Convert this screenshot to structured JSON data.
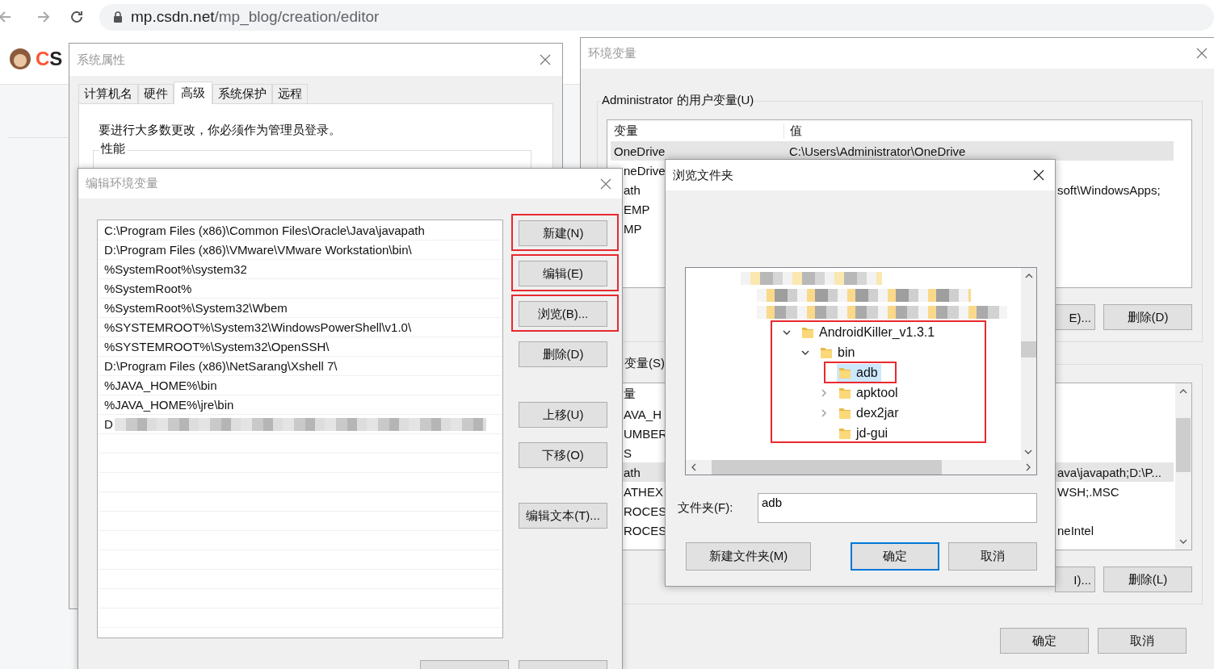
{
  "browser": {
    "url_host": "mp.csdn.net",
    "url_path": "/mp_blog/creation/editor",
    "logo_text": "CS"
  },
  "system_properties": {
    "title": "系统属性",
    "active": false,
    "tabs": [
      {
        "label": "计算机名",
        "selected": false
      },
      {
        "label": "硬件",
        "selected": false
      },
      {
        "label": "高级",
        "selected": true
      },
      {
        "label": "系统保护",
        "selected": false
      },
      {
        "label": "远程",
        "selected": false
      }
    ],
    "notice": "要进行大多数更改，你必须作为管理员登录。",
    "group_label": "性能"
  },
  "environment_variables": {
    "title": "环境变量",
    "active": false,
    "user_group": {
      "label": "Administrator 的用户变量(U)",
      "header": {
        "name": "变量",
        "value": "值"
      },
      "rows": [
        {
          "name": "OneDrive",
          "value": "C:\\Users\\Administrator\\OneDrive",
          "name_cut": false,
          "value_cut": false,
          "selected": true
        },
        {
          "name": "neDrive",
          "name_cut": true,
          "selected": false
        },
        {
          "name": "ath",
          "value": "soft\\WindowsApps;",
          "name_cut": true,
          "value_cut": true,
          "selected": false
        },
        {
          "name": "EMP",
          "name_cut": true,
          "selected": false
        },
        {
          "name": "MP",
          "name_cut": true,
          "selected": false
        }
      ],
      "buttons": [
        "E)...",
        "删除(D)"
      ]
    },
    "system_group": {
      "label": "变量(S)",
      "header": {
        "name": "量"
      },
      "rows": [
        {
          "name": "AVA_H",
          "name_cut": true,
          "selected": false
        },
        {
          "name": "UMBER",
          "name_cut": true,
          "selected": false
        },
        {
          "name": "S",
          "name_cut": true,
          "selected": false
        },
        {
          "name": "ath",
          "value": "ava\\javapath;D:\\P...",
          "name_cut": true,
          "value_cut": true,
          "selected": true
        },
        {
          "name": "ATHEX",
          "value": "WSH;.MSC",
          "name_cut": true,
          "value_cut": true,
          "selected": false
        },
        {
          "name": "ROCES",
          "name_cut": true,
          "selected": false
        },
        {
          "name": "ROCES",
          "value": "neIntel",
          "name_cut": true,
          "value_cut": true,
          "selected": false
        }
      ],
      "buttons": [
        "I)...",
        "删除(L)"
      ]
    },
    "buttons": [
      "确定",
      "取消"
    ]
  },
  "edit_environment_variable": {
    "title": "编辑环境变量",
    "active": false,
    "entries": [
      {
        "text": "C:\\Program Files (x86)\\Common Files\\Oracle\\Java\\javapath",
        "redacted": false
      },
      {
        "text": "D:\\Program Files (x86)\\VMware\\VMware Workstation\\bin\\",
        "redacted": false
      },
      {
        "text": "%SystemRoot%\\system32",
        "redacted": false
      },
      {
        "text": "%SystemRoot%",
        "redacted": false
      },
      {
        "text": "%SystemRoot%\\System32\\Wbem",
        "redacted": false
      },
      {
        "text": "%SYSTEMROOT%\\System32\\WindowsPowerShell\\v1.0\\",
        "redacted": false
      },
      {
        "text": "%SYSTEMROOT%\\System32\\OpenSSH\\",
        "redacted": false
      },
      {
        "text": "D:\\Program Files (x86)\\NetSarang\\Xshell 7\\",
        "redacted": false
      },
      {
        "text": "%JAVA_HOME%\\bin",
        "redacted": false
      },
      {
        "text": "%JAVA_HOME%\\jre\\bin",
        "redacted": false
      },
      {
        "text": "D",
        "redacted": true
      }
    ],
    "buttons": [
      {
        "label": "新建(N)",
        "highlighted": true
      },
      {
        "label": "编辑(E)",
        "highlighted": true
      },
      {
        "label": "浏览(B)...",
        "highlighted": true
      },
      {
        "label": "删除(D)",
        "highlighted": false
      },
      {
        "label": "上移(U)",
        "highlighted": false
      },
      {
        "label": "下移(O)",
        "highlighted": false
      },
      {
        "label": "编辑文本(T)...",
        "highlighted": false
      }
    ]
  },
  "browse_folder": {
    "title": "浏览文件夹",
    "active": true,
    "tree": [
      {
        "label": "AndroidKiller_v1.3.1",
        "expanded": true,
        "selected": false,
        "highlighted": true,
        "children": [
          {
            "label": "bin",
            "expanded": true,
            "selected": false,
            "highlighted": false,
            "children": [
              {
                "label": "adb",
                "selected": true,
                "highlighted": true
              },
              {
                "label": "apktool",
                "expanded": false,
                "selected": false,
                "highlighted": false
              },
              {
                "label": "dex2jar",
                "expanded": false,
                "selected": false,
                "highlighted": false
              },
              {
                "label": "jd-gui",
                "selected": false,
                "highlighted": false
              }
            ]
          }
        ]
      }
    ],
    "folder_label": "文件夹(F):",
    "folder_value": "adb",
    "buttons": [
      "新建文件夹(M)",
      "确定",
      "取消"
    ]
  }
}
